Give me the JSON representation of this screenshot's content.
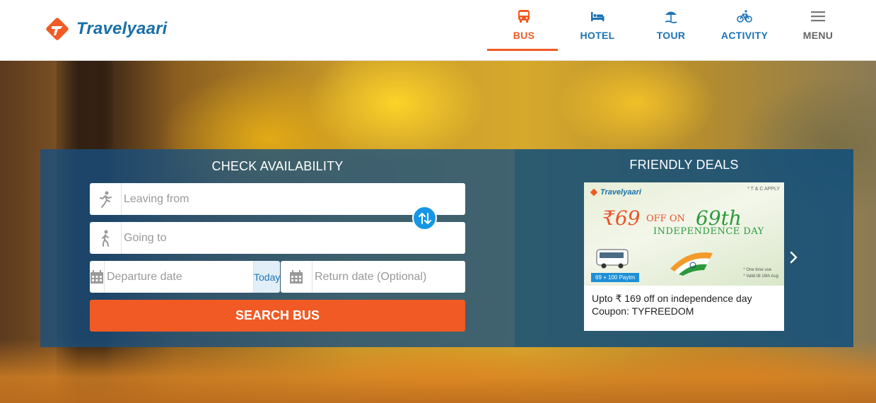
{
  "brand": {
    "name": "Travelyaari"
  },
  "nav": {
    "items": [
      {
        "label": "BUS",
        "icon": "bus-icon",
        "active": true
      },
      {
        "label": "HOTEL",
        "icon": "bed-icon",
        "active": false
      },
      {
        "label": "TOUR",
        "icon": "beach-umbrella-icon",
        "active": false
      },
      {
        "label": "ACTIVITY",
        "icon": "bicycle-icon",
        "active": false
      },
      {
        "label": "MENU",
        "icon": "hamburger-icon",
        "active": false
      }
    ]
  },
  "availability": {
    "title": "CHECK AVAILABILITY",
    "leaving_placeholder": "Leaving from",
    "going_placeholder": "Going to",
    "departure_placeholder": "Departure date",
    "today_label": "Today",
    "return_placeholder": "Return date (Optional)",
    "search_label": "SEARCH BUS"
  },
  "deals": {
    "title": "FRIENDLY DEALS",
    "banner": {
      "brand": "Travelyaari",
      "tc": "* T & C APPLY",
      "offer": "₹69",
      "off_on": "OFF ON",
      "number": "69th",
      "occasion": "INDEPENDENCE DAY",
      "paytm": "69 + 100 Paytm",
      "foot_1": "* One time use",
      "foot_2": "* Valid till 16th Aug"
    },
    "text_line1": "Upto ₹ 169 off on independence day",
    "text_line2": "Coupon: TYFREEDOM"
  },
  "colors": {
    "accent": "#f15a24",
    "brand_blue": "#1a73b5",
    "panel_blue": "#165082"
  }
}
